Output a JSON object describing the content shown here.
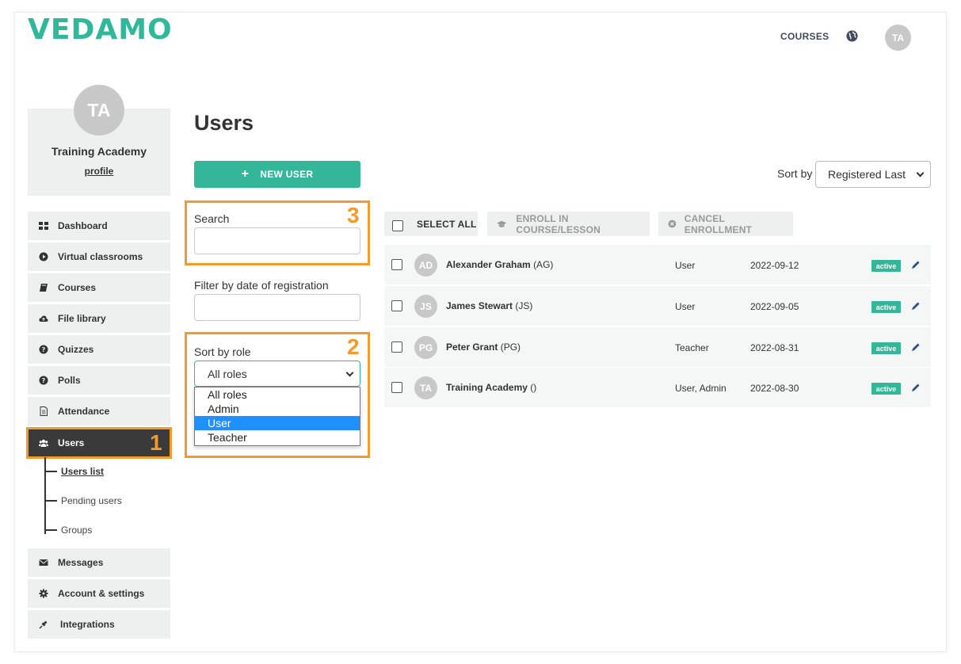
{
  "header": {
    "logo": "VEDAMO",
    "nav_courses": "COURSES",
    "user_initials": "TA"
  },
  "profile": {
    "initials": "TA",
    "name": "Training Academy",
    "link": "profile"
  },
  "sidebar": {
    "items": [
      {
        "label": "Dashboard",
        "icon": "dashboard-icon"
      },
      {
        "label": "Virtual classrooms",
        "icon": "play-icon"
      },
      {
        "label": "Courses",
        "icon": "book-icon"
      },
      {
        "label": "File library",
        "icon": "cloud-upload-icon"
      },
      {
        "label": "Quizzes",
        "icon": "question-icon"
      },
      {
        "label": "Polls",
        "icon": "question-icon"
      },
      {
        "label": "Attendance",
        "icon": "document-icon"
      },
      {
        "label": "Users",
        "icon": "users-icon"
      },
      {
        "label": "Messages",
        "icon": "envelope-icon"
      },
      {
        "label": "Account & settings",
        "icon": "gear-icon"
      },
      {
        "label": "Integrations",
        "icon": "plug-icon"
      }
    ],
    "users_sub": [
      "Users list",
      "Pending users",
      "Groups"
    ]
  },
  "callouts": {
    "one": "1",
    "two": "2",
    "three": "3"
  },
  "main": {
    "title": "Users",
    "new_user": "NEW USER",
    "sort_by_label": "Sort by",
    "sort_by_value": "Registered Last",
    "search_label": "Search",
    "search_value": "",
    "filter_date_label": "Filter by date of registration",
    "sort_role_label": "Sort by role",
    "sort_role_value": "All roles",
    "role_options": [
      "All roles",
      "Admin",
      "User",
      "Teacher"
    ],
    "selected_role_option": "User",
    "toolbar": {
      "select_all": "SELECT ALL",
      "enroll": "ENROLL IN COURSE/LESSON",
      "cancel": "CANCEL ENROLLMENT"
    },
    "users": [
      {
        "initials": "AD",
        "name": "Alexander Graham",
        "abbr": "(AG)",
        "role": "User",
        "date": "2022-09-12",
        "status": "active"
      },
      {
        "initials": "JS",
        "name": "James Stewart",
        "abbr": "(JS)",
        "role": "User",
        "date": "2022-09-05",
        "status": "active"
      },
      {
        "initials": "PG",
        "name": "Peter Grant",
        "abbr": "(PG)",
        "role": "Teacher",
        "date": "2022-08-31",
        "status": "active"
      },
      {
        "initials": "TA",
        "name": "Training Academy",
        "abbr": "()",
        "role": "User, Admin",
        "date": "2022-08-30",
        "status": "active"
      }
    ]
  },
  "colors": {
    "accent": "#34b798",
    "highlight": "#f39a2b",
    "dark": "#3a3a3a"
  }
}
